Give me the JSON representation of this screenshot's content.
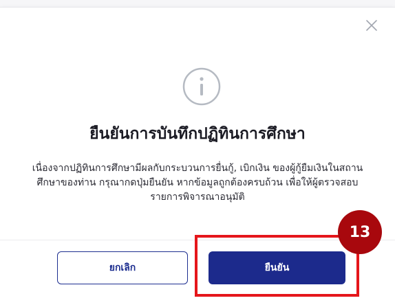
{
  "dialog": {
    "close_icon": "close-icon",
    "status_icon": "info-circle-icon",
    "title": "ยืนยันการบันทึกปฏิทินการศึกษา",
    "message_lines": [
      "เนื่องจากปฏิทินการศึกษามีผลกับกระบวนการยื่นกู้, เบิกเงิน ของผู้กู้ยืมเงินในสถาน",
      "ศึกษาของท่าน กรุณากดปุ่มยืนยัน หากข้อมูลถูกต้องครบถ้วน เพื่อให้ผู้ตรวจสอบ",
      "รายการพิจารณาอนุมัติ"
    ],
    "cancel_label": "ยกเลิก",
    "confirm_label": "ยืนยัน"
  },
  "annotation": {
    "step_number": "13"
  },
  "colors": {
    "primary": "#1c2a8c",
    "highlight": "#e5161b",
    "badge": "#a8080d",
    "icon_gray": "#b5bac2"
  }
}
